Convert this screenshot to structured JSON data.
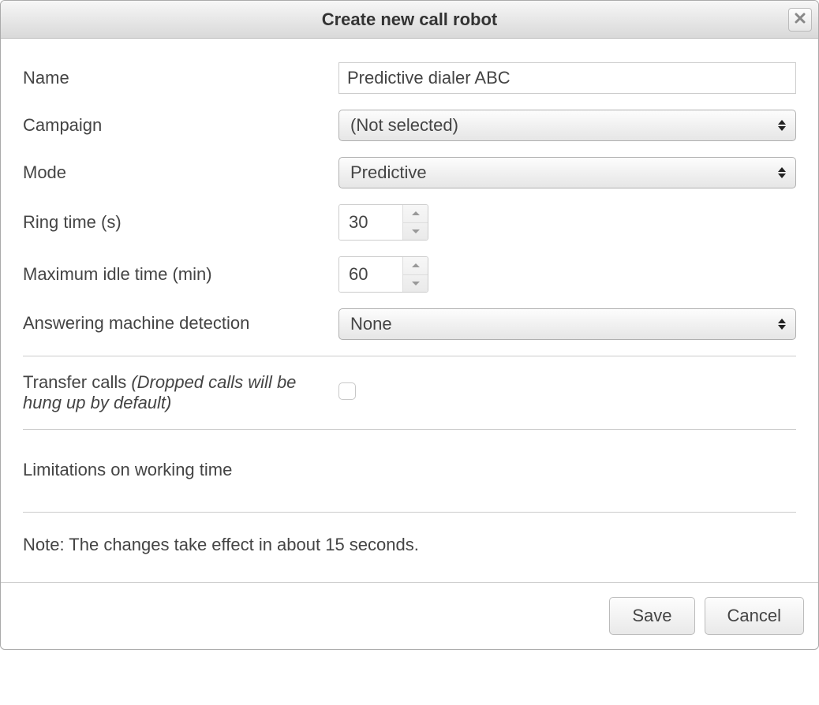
{
  "dialog": {
    "title": "Create new call robot"
  },
  "form": {
    "name_label": "Name",
    "name_value": "Predictive dialer ABC",
    "campaign_label": "Campaign",
    "campaign_value": "(Not selected)",
    "mode_label": "Mode",
    "mode_value": "Predictive",
    "ring_time_label": "Ring time (s)",
    "ring_time_value": "30",
    "idle_time_label": "Maximum idle time (min)",
    "idle_time_value": "60",
    "amd_label": "Answering machine detection",
    "amd_value": "None",
    "transfer_label": "Transfer calls ",
    "transfer_hint": "(Dropped calls will be hung up by default)",
    "limitations_heading": "Limitations on working time",
    "note": "Note: The changes take effect in about 15 seconds."
  },
  "buttons": {
    "save": "Save",
    "cancel": "Cancel"
  }
}
